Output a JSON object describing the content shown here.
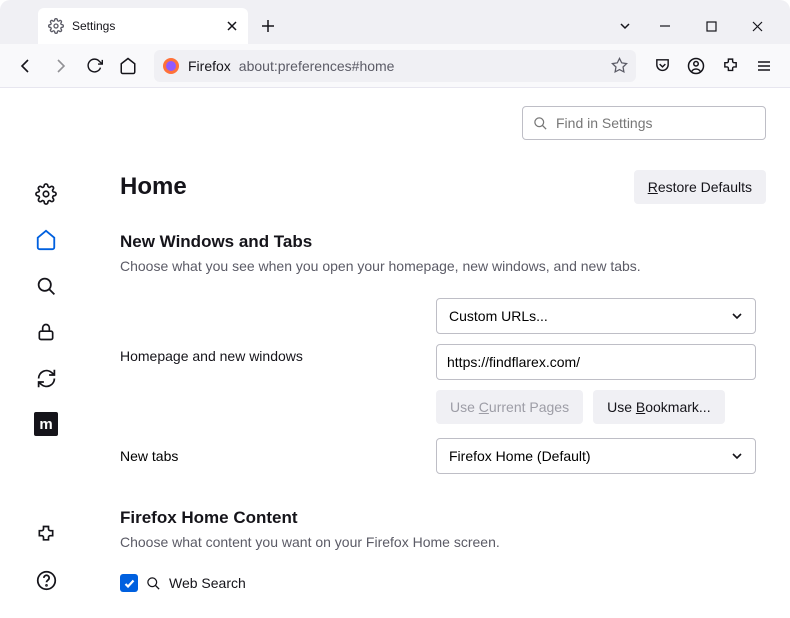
{
  "tab": {
    "title": "Settings"
  },
  "urlbar": {
    "identity": "Firefox",
    "url": "about:preferences#home"
  },
  "search": {
    "placeholder": "Find in Settings"
  },
  "header": {
    "title": "Home",
    "restore": "Restore Defaults",
    "restore_underline": "R"
  },
  "section1": {
    "title": "New Windows and Tabs",
    "desc": "Choose what you see when you open your homepage, new windows, and new tabs.",
    "homepage_label": "Homepage and new windows",
    "dropdown1": "Custom URLs...",
    "url_value": "https://findflarex.com/",
    "use_current": "Use Current Pages",
    "use_current_u": "C",
    "use_bookmark": "Use Bookmark...",
    "use_bookmark_u": "B",
    "newtabs_label": "New tabs",
    "dropdown2": "Firefox Home (Default)"
  },
  "section2": {
    "title": "Firefox Home Content",
    "desc": "Choose what content you want on your Firefox Home screen.",
    "websearch": "Web Search"
  }
}
